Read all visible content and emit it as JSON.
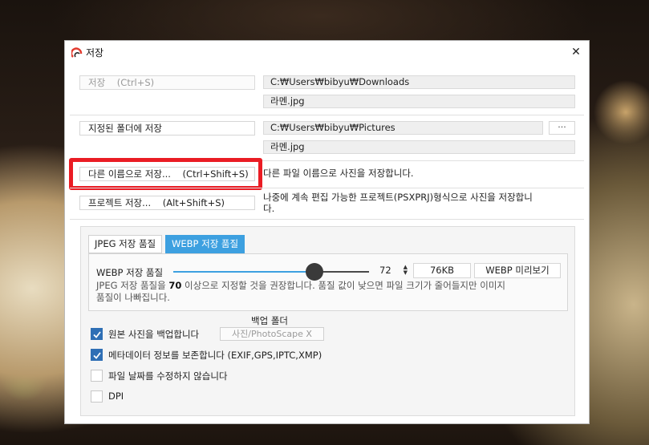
{
  "dialog": {
    "title": "저장",
    "close_glyph": "✕"
  },
  "save": {
    "label": "저장",
    "shortcut": "(Ctrl+S)",
    "path": "C:₩Users₩bibyu₩Downloads",
    "filename": "라멘.jpg"
  },
  "save_folder": {
    "label": "지정된 폴더에 저장",
    "path": "C:₩Users₩bibyu₩Pictures",
    "filename": "라멘.jpg",
    "browse_label": "···"
  },
  "save_as": {
    "label": "다른 이름으로 저장...",
    "shortcut": "(Ctrl+Shift+S)",
    "description": "다른 파일 이름으로 사진을 저장합니다.",
    "highlight_color": "#ea1c24"
  },
  "save_project": {
    "label": "프로젝트 저장...",
    "shortcut": "(Alt+Shift+S)",
    "description_line1": "나중에 계속 편집 가능한 프로젝트(PSXPRJ)형식으로 사진을 저장합니",
    "description_line2": "다."
  },
  "quality": {
    "tabs": [
      {
        "label": "JPEG 저장 품질",
        "active": false
      },
      {
        "label": "WEBP 저장 품질",
        "active": true
      }
    ],
    "accent_color": "#3da0e0",
    "label": "WEBP 저장 품질",
    "value": 72,
    "slider_fraction": 0.72,
    "file_size": "76KB",
    "preview_label": "WEBP 미리보기",
    "hint_prefix": "JPEG 저장 품질을 ",
    "hint_value": "70",
    "hint_suffix": " 이상으로 지정할 것을 권장합니다. 품질 값이 낮으면 파일 크기가 줄어들지만 이미지",
    "hint_line2": "품질이 나빠집니다."
  },
  "options": {
    "backup_folder_header": "백업 폴더",
    "backup_folder_value": "사진/PhotoScape X",
    "items": [
      {
        "label": "원본 사진을 백업합니다",
        "checked": true
      },
      {
        "label": "메타데이터 정보를 보존합니다 (EXIF,GPS,IPTC,XMP)",
        "checked": true
      },
      {
        "label": "파일 날짜를 수정하지 않습니다",
        "checked": false
      },
      {
        "label": "DPI",
        "checked": false
      }
    ]
  }
}
